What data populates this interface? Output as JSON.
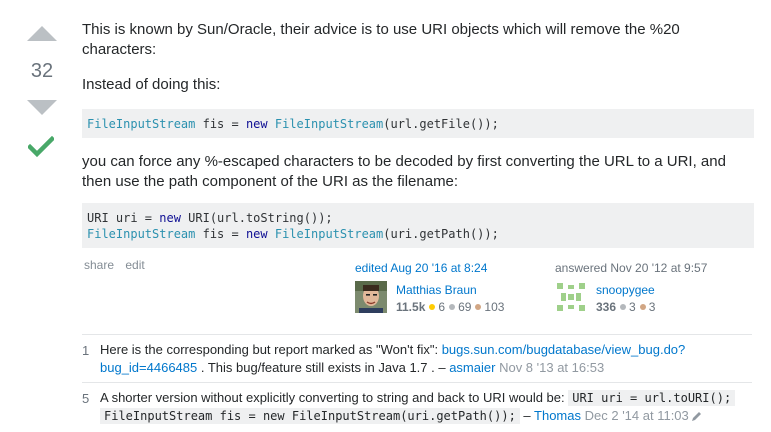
{
  "vote": {
    "count": "32"
  },
  "post": {
    "para1": "This is known by Sun/Oracle, their advice is to use URI objects which will remove the %20 characters:",
    "para2": "Instead of doing this:",
    "code1": {
      "line1": {
        "t1": "FileInputStream",
        "t2": " fis = ",
        "t3": "new",
        "t4": " ",
        "t5": "FileInputStream",
        "t6": "(url.getFile());"
      }
    },
    "para3": "you can force any %-escaped characters to be decoded by first converting the URL to a URI, and then use the path component of the URI as the filename:",
    "code2": {
      "line1": {
        "t1": "URI uri = ",
        "t2": "new",
        "t3": " URI(url.toString());"
      },
      "line2": {
        "t1": "FileInputStream",
        "t2": " fis = ",
        "t3": "new",
        "t4": " ",
        "t5": "FileInputStream",
        "t6": "(uri.getPath());"
      }
    }
  },
  "menu": {
    "share": "share",
    "edit": "edit"
  },
  "edited": {
    "action": "edited Aug 20 '16 at 8:24",
    "user": "Matthias Braun",
    "rep": "11.5k",
    "gold": "6",
    "silver": "69",
    "bronze": "103"
  },
  "answered": {
    "action": "answered Nov 20 '12 at 9:57",
    "user": "snoopygee",
    "rep": "336",
    "silver": "3",
    "bronze": "3"
  },
  "comments": [
    {
      "score": "1",
      "text1": "Here is the corresponding but report marked as \"Won't fix\": ",
      "link": "bugs.sun.com/bugdatabase/view_bug.do?bug_id=4466485",
      "text2": " . This bug/feature still exists in Java 1.7 . – ",
      "user": "asmaier",
      "date": "Nov 8 '13 at 16:53"
    },
    {
      "score": "5",
      "text1": "A shorter version without explicitly converting to string and back to URI would be: ",
      "code1": "URI uri = url.toURI();",
      "code2": "FileInputStream fis = new FileInputStream(uri.getPath());",
      "text2": " – ",
      "user": "Thomas",
      "date": "Dec 2 '14 at 11:03"
    }
  ],
  "colors": {
    "accent_link": "#0077cc",
    "accepted_check": "#48a868",
    "code_bg": "#eff0f1"
  },
  "icons": [
    "upvote-arrow-icon",
    "downvote-arrow-icon",
    "accepted-check-icon",
    "pencil-icon"
  ]
}
